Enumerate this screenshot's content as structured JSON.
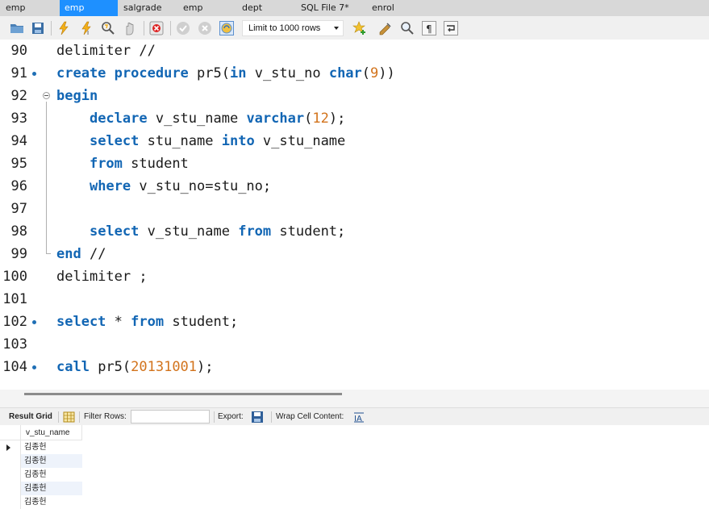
{
  "tabs": [
    {
      "label": "emp",
      "active": false
    },
    {
      "label": "emp",
      "active": true
    },
    {
      "label": "salgrade",
      "active": false
    },
    {
      "label": "emp",
      "active": false
    },
    {
      "label": "dept",
      "active": false
    },
    {
      "label": "SQL File 7*",
      "active": false
    },
    {
      "label": "enrol",
      "active": false
    }
  ],
  "toolbar": {
    "limit_label": "Limit to 1000 rows",
    "icons": [
      "open-folder-icon",
      "save-icon",
      "execute-icon",
      "execute-current-icon",
      "explain-icon",
      "stop-icon",
      "toggle-errors-icon",
      "commit-icon",
      "rollback-icon",
      "autocommit-icon",
      "add-snippet-icon",
      "beautify-icon",
      "find-icon",
      "invisibles-icon",
      "wrap-icon"
    ]
  },
  "editor": {
    "lines": [
      {
        "n": "90",
        "text": "delimiter //"
      },
      {
        "n": "91",
        "text": "create procedure pr5(in v_stu_no char(9))"
      },
      {
        "n": "92",
        "text": "begin"
      },
      {
        "n": "93",
        "text": "    declare v_stu_name varchar(12);"
      },
      {
        "n": "94",
        "text": "    select stu_name into v_stu_name"
      },
      {
        "n": "95",
        "text": "    from student"
      },
      {
        "n": "96",
        "text": "    where v_stu_no=stu_no;"
      },
      {
        "n": "97",
        "text": ""
      },
      {
        "n": "98",
        "text": "    select v_stu_name from student;"
      },
      {
        "n": "99",
        "text": "end //"
      },
      {
        "n": "100",
        "text": "delimiter ;"
      },
      {
        "n": "101",
        "text": ""
      },
      {
        "n": "102",
        "text": "select * from student;"
      },
      {
        "n": "103",
        "text": ""
      },
      {
        "n": "104",
        "text": "call pr5(20131001);"
      }
    ]
  },
  "result_toolbar": {
    "result_grid_label": "Result Grid",
    "filter_rows_label": "Filter Rows:",
    "filter_value": "",
    "export_label": "Export:",
    "wrap_label": "Wrap Cell Content:"
  },
  "grid": {
    "columns": [
      "v_stu_name"
    ],
    "rows": [
      "김종헌",
      "김종헌",
      "김종헌",
      "김종헌",
      "김종헌"
    ]
  },
  "colors": {
    "keyword": "#1266b4",
    "number": "#d2731c",
    "active_tab": "#1e90ff"
  }
}
